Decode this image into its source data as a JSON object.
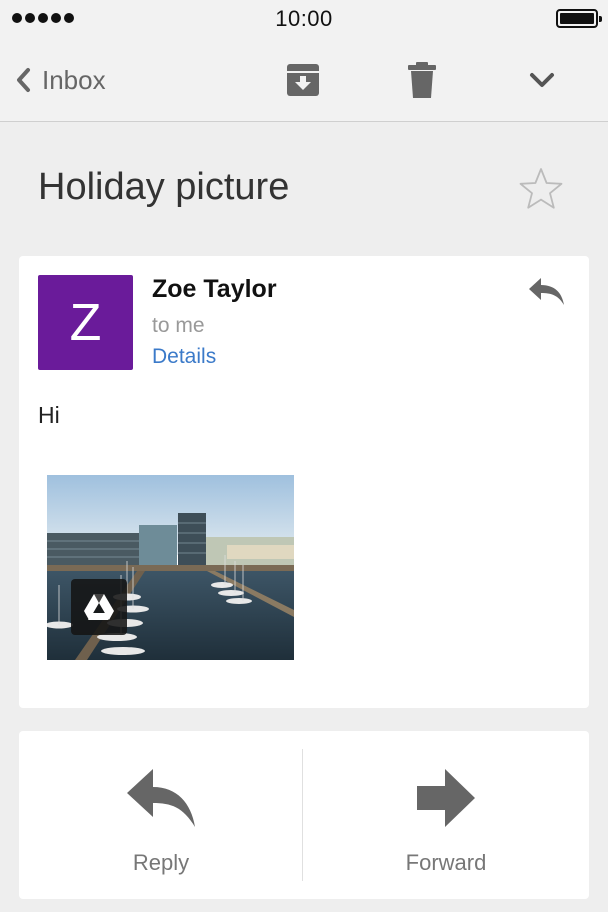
{
  "status_bar": {
    "time": "10:00",
    "signal_icon": "signal-dots-icon",
    "battery_icon": "battery-icon"
  },
  "toolbar": {
    "back_label": "Inbox",
    "archive_icon": "archive-icon",
    "delete_icon": "trash-icon",
    "more_icon": "chevron-down-icon"
  },
  "email": {
    "subject": "Holiday picture",
    "starred": false,
    "sender_initial": "Z",
    "sender_name": "Zoe Taylor",
    "recipient_text": "to me",
    "details_link": "Details",
    "body": "Hi",
    "avatar_color": "#6a1b9a",
    "attachment_icon": "google-drive-icon"
  },
  "actions": {
    "reply_label": "Reply",
    "forward_label": "Forward"
  },
  "colors": {
    "link": "#3b7ac9",
    "background": "#eeeeee",
    "icon_gray": "#666666"
  }
}
